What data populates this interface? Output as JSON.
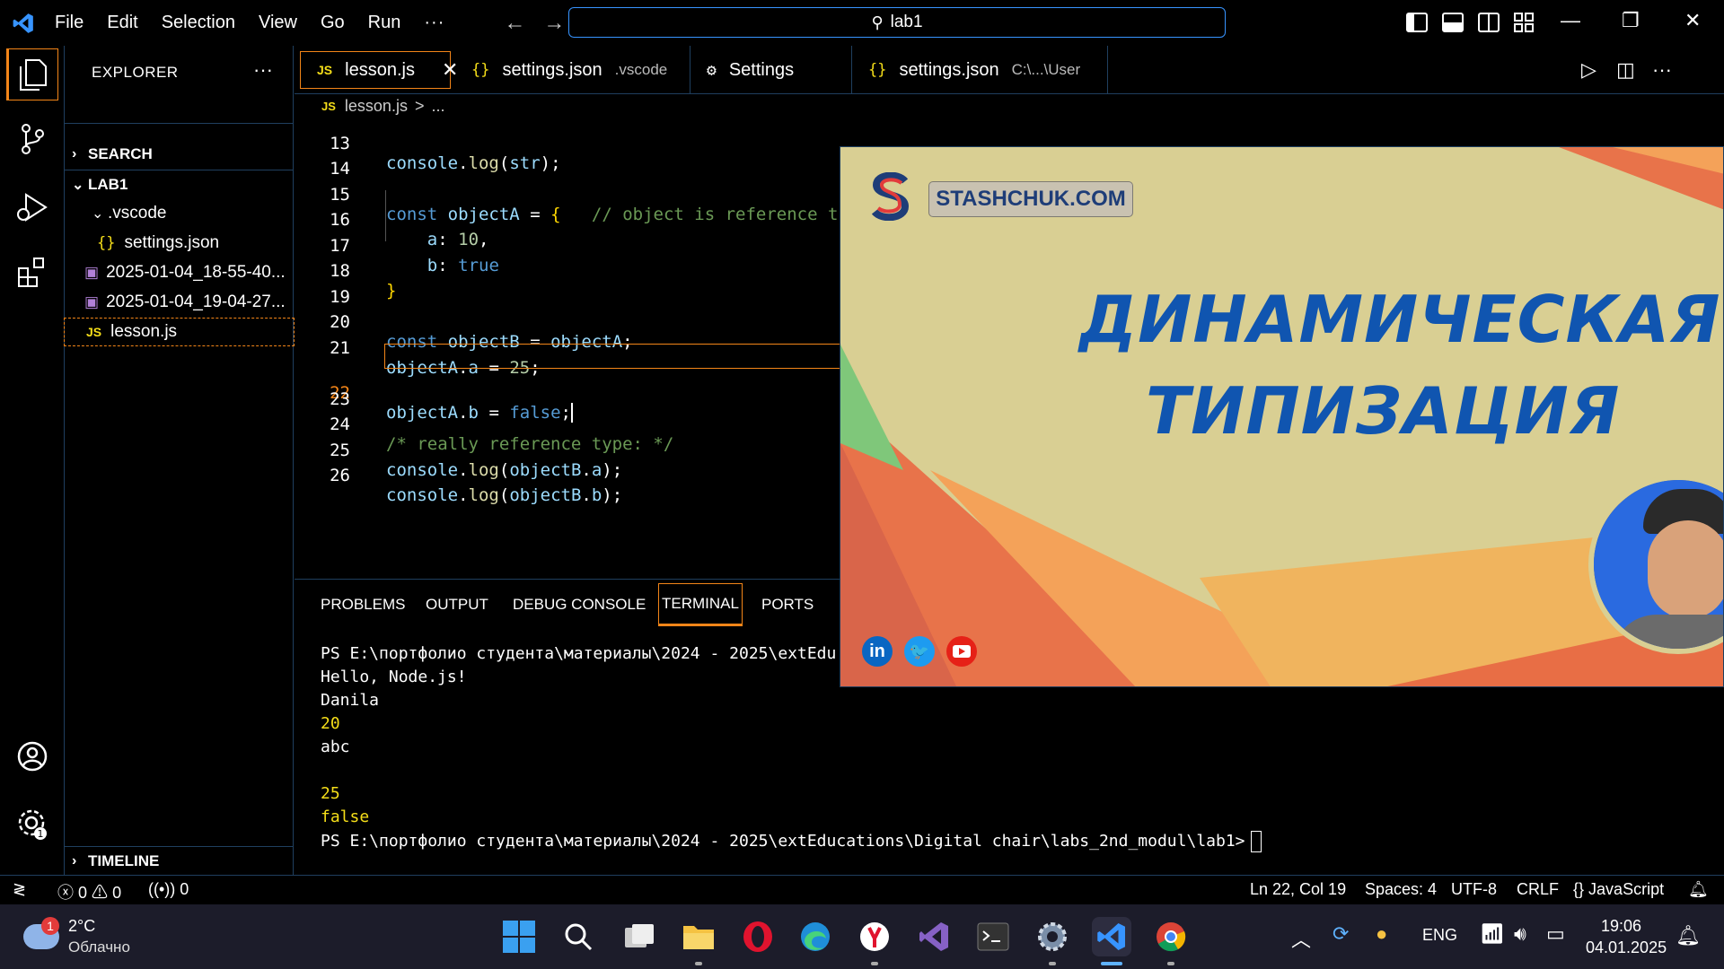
{
  "titlebar": {
    "menu": [
      "File",
      "Edit",
      "Selection",
      "View",
      "Go",
      "Run"
    ],
    "more": "···",
    "search_text": "lab1"
  },
  "sidebar": {
    "title": "EXPLORER",
    "dots": "···",
    "search_section": "SEARCH",
    "folder_name": "LAB1",
    "vscode_folder": ".vscode",
    "settings_file": "settings.json",
    "image1": "2025-01-04_18-55-40...",
    "image2": "2025-01-04_19-04-27...",
    "lesson_file": "lesson.js",
    "timeline": "TIMELINE"
  },
  "tabs": [
    {
      "icon": "JS",
      "label": "lesson.js",
      "desc": ""
    },
    {
      "icon": "{}",
      "label": "settings.json",
      "desc": ".vscode"
    },
    {
      "icon": "⚙",
      "label": "Settings",
      "desc": ""
    },
    {
      "icon": "{}",
      "label": "settings.json",
      "desc": "C:\\...\\User"
    }
  ],
  "breadcrumb": {
    "icon": "JS",
    "file": "lesson.js",
    "sep": ">",
    "rest": "..."
  },
  "editor": {
    "lines": [
      {
        "n": "13",
        "text": "console.log(str);"
      },
      {
        "n": "14",
        "text": ""
      },
      {
        "n": "15",
        "text": "const objectA = {   // object is reference t"
      },
      {
        "n": "16",
        "text": "    a: 10,"
      },
      {
        "n": "17",
        "text": "    b: true"
      },
      {
        "n": "18",
        "text": "}"
      },
      {
        "n": "19",
        "text": ""
      },
      {
        "n": "20",
        "text": "const objectB = objectA;"
      },
      {
        "n": "21",
        "text": "objectA.a = 25;"
      },
      {
        "n": "22",
        "text": "objectA.b = false;"
      },
      {
        "n": "23",
        "text": ""
      },
      {
        "n": "24",
        "text": "/* really reference type: */"
      },
      {
        "n": "25",
        "text": "console.log(objectB.a);"
      },
      {
        "n": "26",
        "text": "console.log(objectB.b);"
      }
    ]
  },
  "panel": {
    "tabs": [
      "PROBLEMS",
      "OUTPUT",
      "DEBUG CONSOLE",
      "TERMINAL",
      "PORTS"
    ],
    "terminal": [
      "PS E:\\портфолио студента\\материалы\\2024 - 2025\\extEdu",
      "Hello, Node.js!",
      "Danila",
      "20",
      "abc",
      "",
      "25",
      "false",
      "PS E:\\портфолио студента\\материалы\\2024 - 2025\\extEducations\\Digital chair\\labs_2nd_modul\\lab1>"
    ]
  },
  "video": {
    "logo_text": "STASHCHUK.COM",
    "headline_1": "ДИНАМИЧЕСКАЯ",
    "headline_2": "ТИПИЗАЦИЯ"
  },
  "statusbar": {
    "errors": "0",
    "warnings": "0",
    "ports": "0",
    "position": "Ln 22, Col 19",
    "spaces": "Spaces: 4",
    "encoding": "UTF-8",
    "eol": "CRLF",
    "language": "JavaScript"
  },
  "taskbar": {
    "weather_temp": "2°C",
    "weather_desc": "Облачно",
    "weather_badge": "1",
    "lang": "ENG",
    "time": "19:06",
    "date": "04.01.2025"
  },
  "colors": {
    "accent": "#f38518",
    "focus": "#3794ff",
    "keyword": "#569cd6",
    "variable": "#9cdcfe",
    "number": "#b5cea8",
    "comment": "#6a9955",
    "video_bg": "#d9cf93",
    "headline": "#1055b0"
  }
}
